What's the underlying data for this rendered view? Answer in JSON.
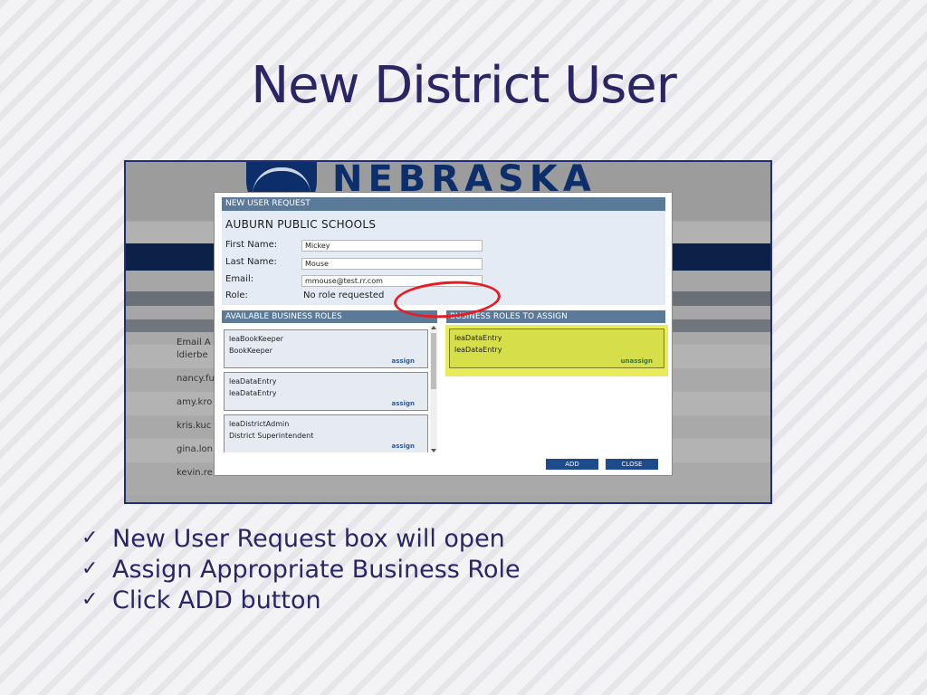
{
  "slide": {
    "title": "New District User",
    "bullets": [
      "New User Request box will open",
      "Assign Appropriate Business Role",
      "Click ADD button"
    ]
  },
  "background_app": {
    "logo_text": "NEBRASKA",
    "list_header": "Email A",
    "list_rows": [
      "ldierbe",
      "nancy.fu",
      "amy.kro",
      "kris.kuc",
      "gina.lon",
      "kevin.re"
    ]
  },
  "dialog": {
    "header": "NEW USER REQUEST",
    "school": "AUBURN PUBLIC SCHOOLS",
    "fields": {
      "first_name_label": "First Name:",
      "first_name_value": "Mickey",
      "last_name_label": "Last Name:",
      "last_name_value": "Mouse",
      "email_label": "Email:",
      "email_value": "mmouse@test.rr.com",
      "role_label": "Role:",
      "role_value": "No role requested"
    },
    "available_header": "AVAILABLE BUSINESS ROLES",
    "assign_header": "BUSINESS ROLES TO ASSIGN",
    "available_roles": [
      {
        "code": "leaBookKeeper",
        "name": "BookKeeper",
        "action": "assign"
      },
      {
        "code": "leaDataEntry",
        "name": "leaDataEntry",
        "action": "assign"
      },
      {
        "code": "leaDistrictAdmin",
        "name": "District Superintendent",
        "action": "assign"
      }
    ],
    "assigned_roles": [
      {
        "code": "leaDataEntry",
        "name": "leaDataEntry",
        "action": "unassign"
      }
    ],
    "add_button": "ADD",
    "close_button": "CLOSE"
  },
  "colors": {
    "title": "#2a2563",
    "section_header": "#5b7a99",
    "button": "#1d4b8c",
    "highlight": "#e8ec5c",
    "callout_circle": "#e31e24"
  }
}
